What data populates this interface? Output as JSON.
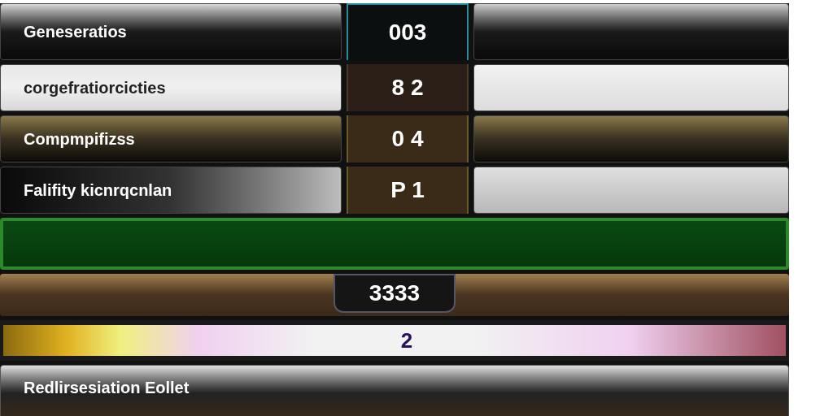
{
  "rows": [
    {
      "kind": "label_row",
      "label": "Geneseratios",
      "value": "003"
    },
    {
      "kind": "label_row",
      "label": "corgefratiorcicties",
      "value": "8 2"
    },
    {
      "kind": "label_row",
      "label": "Compmpifizss",
      "value": "0 4"
    },
    {
      "kind": "label_row",
      "label": "Falifity kicnrqcnlan",
      "value": "P 1"
    },
    {
      "kind": "bar"
    },
    {
      "kind": "counter_row",
      "value": "3333"
    },
    {
      "kind": "gradient_row",
      "value": "2"
    },
    {
      "kind": "title_row",
      "label": "Redlirsesiation Eollet"
    }
  ]
}
